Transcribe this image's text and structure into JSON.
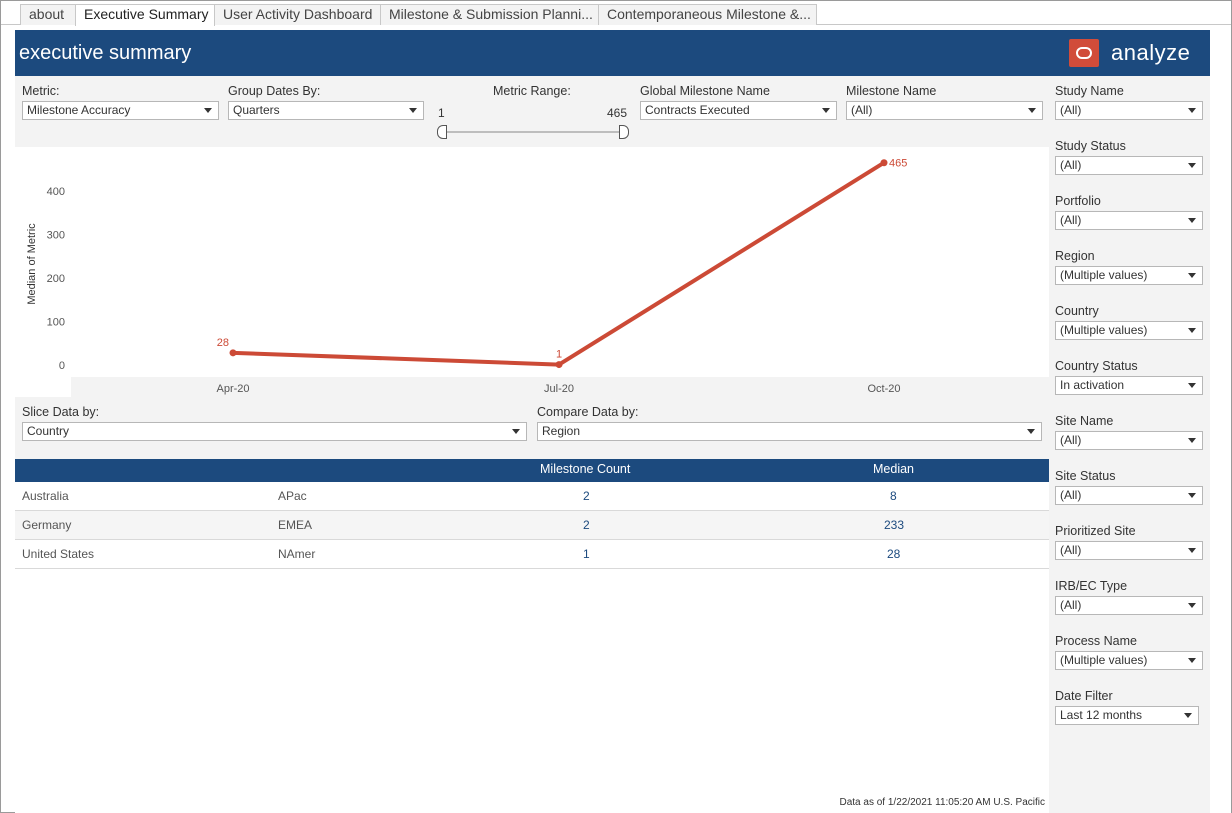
{
  "tabs": [
    {
      "label": "about",
      "active": false
    },
    {
      "label": "Executive Summary",
      "active": true
    },
    {
      "label": "User Activity Dashboard",
      "active": false
    },
    {
      "label": "Milestone & Submission Planni...",
      "active": false
    },
    {
      "label": "Contemporaneous Milestone &...",
      "active": false
    }
  ],
  "header": {
    "title": "executive summary"
  },
  "brand": {
    "name": "analyze",
    "color": "#d14c3a"
  },
  "controls": {
    "metric": {
      "label": "Metric:",
      "value": "Milestone Accuracy"
    },
    "group_dates": {
      "label": "Group Dates By:",
      "value": "Quarters"
    },
    "metric_range": {
      "label": "Metric Range:",
      "min": "1",
      "max": "465"
    },
    "global_milestone": {
      "label": "Global Milestone Name",
      "value": "Contracts Executed"
    },
    "milestone_name": {
      "label": "Milestone Name",
      "value": "(All)"
    }
  },
  "chart_data": {
    "type": "line",
    "ylabel": "Median of Metric",
    "categories": [
      "Apr-20",
      "Jul-20",
      "Oct-20"
    ],
    "series": [
      {
        "values": [
          28,
          1,
          465
        ],
        "color": "#cc4a36"
      }
    ],
    "data_labels": [
      "28",
      "1",
      "465"
    ],
    "yticks": [
      "0",
      "100",
      "200",
      "300",
      "400"
    ],
    "ylim": [
      0,
      470
    ],
    "grid": false
  },
  "slice": {
    "label": "Slice Data by:",
    "value": "Country"
  },
  "compare": {
    "label": "Compare Data by:",
    "value": "Region"
  },
  "table": {
    "headers": {
      "count": "Milestone Count",
      "median": "Median"
    },
    "rows": [
      {
        "country": "Australia",
        "region": "APac",
        "count": "2",
        "median": "8"
      },
      {
        "country": "Germany",
        "region": "EMEA",
        "count": "2",
        "median": "233"
      },
      {
        "country": "United States",
        "region": "NAmer",
        "count": "1",
        "median": "28"
      }
    ]
  },
  "footnote": "Data as of 1/22/2021 11:05:20 AM U.S. Pacific",
  "filters": [
    {
      "label": "Study Name",
      "value": "(All)"
    },
    {
      "label": "Study Status",
      "value": "(All)"
    },
    {
      "label": "Portfolio",
      "value": "(All)"
    },
    {
      "label": "Region",
      "value": "(Multiple values)"
    },
    {
      "label": "Country",
      "value": "(Multiple values)"
    },
    {
      "label": "Country Status",
      "value": "In activation"
    },
    {
      "label": "Site Name",
      "value": "(All)"
    },
    {
      "label": "Site Status",
      "value": "(All)"
    },
    {
      "label": "Prioritized Site",
      "value": "(All)"
    },
    {
      "label": "IRB/EC Type",
      "value": "(All)"
    },
    {
      "label": "Process Name",
      "value": "(Multiple values)"
    },
    {
      "label": "Date Filter",
      "value": "Last 12 months"
    }
  ]
}
